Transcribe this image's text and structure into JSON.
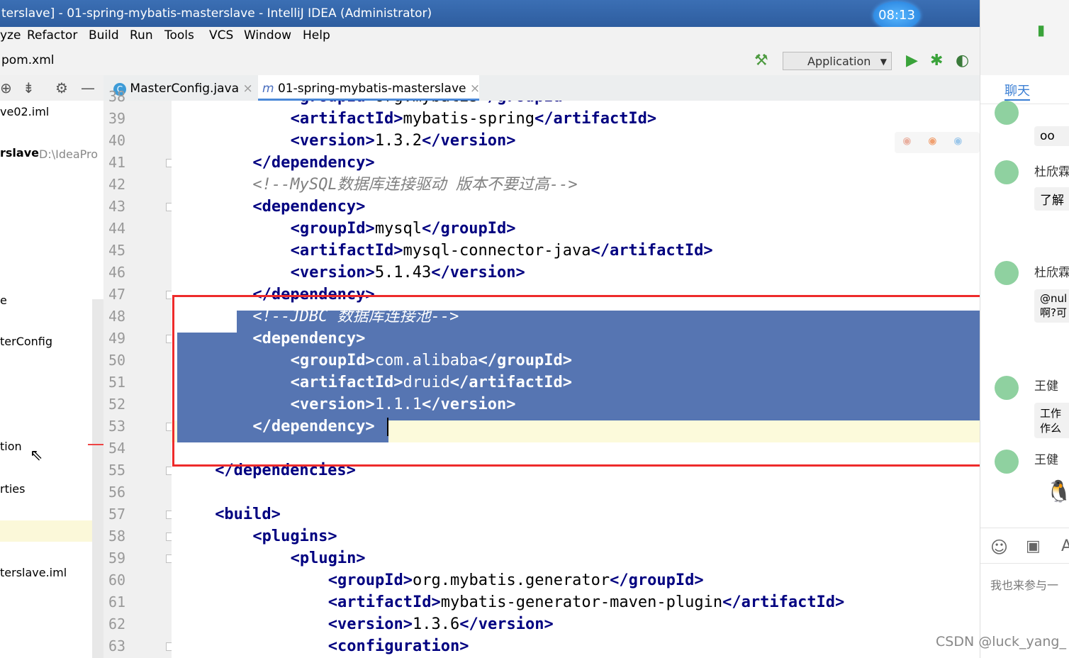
{
  "window": {
    "title": "terslave] - 01-spring-mybatis-masterslave - IntelliJ IDEA (Administrator)",
    "clock": "08:13"
  },
  "menu": [
    "yze",
    "Refactor",
    "Build",
    "Run",
    "Tools",
    "VCS",
    "Window",
    "Help"
  ],
  "navbar": {
    "crumb": "pom.xml",
    "run_config": "Application"
  },
  "tabs": [
    {
      "label": "MasterConfig.java",
      "icon": "C",
      "close": "×"
    },
    {
      "label": "01-spring-mybatis-masterslave",
      "icon": "m",
      "close": "×"
    }
  ],
  "project_items": [
    "ve02.iml",
    "rslave",
    "D:\\IdeaPro",
    "e",
    "terConfig",
    "tion",
    "rties",
    "terslave.iml"
  ],
  "gutter": {
    "lines": [
      "38",
      "39",
      "40",
      "41",
      "42",
      "43",
      "44",
      "45",
      "46",
      "47",
      "48",
      "49",
      "50",
      "51",
      "52",
      "53",
      "54",
      "55",
      "56",
      "57",
      "58",
      "59",
      "60",
      "61",
      "62",
      "63"
    ]
  },
  "code": [
    {
      "indent": "            ",
      "open": "<groupId>",
      "text": "org.mybatis",
      "close": "</groupId>"
    },
    {
      "indent": "            ",
      "open": "<artifactId>",
      "text": "mybatis-spring",
      "close": "</artifactId>"
    },
    {
      "indent": "            ",
      "open": "<version>",
      "text": "1.3.2",
      "close": "</version>"
    },
    {
      "indent": "        ",
      "open": "</dependency>",
      "text": "",
      "close": ""
    },
    {
      "indent": "        ",
      "comment": "<!--MySQL数据库连接驱动 版本不要过高-->"
    },
    {
      "indent": "        ",
      "open": "<dependency>",
      "text": "",
      "close": ""
    },
    {
      "indent": "            ",
      "open": "<groupId>",
      "text": "mysql",
      "close": "</groupId>"
    },
    {
      "indent": "            ",
      "open": "<artifactId>",
      "text": "mysql-connector-java",
      "close": "</artifactId>"
    },
    {
      "indent": "            ",
      "open": "<version>",
      "text": "5.1.43",
      "close": "</version>"
    },
    {
      "indent": "        ",
      "open": "</dependency>",
      "text": "",
      "close": ""
    },
    {
      "indent": "        ",
      "comment": "<!--JDBC 数据库连接池-->"
    },
    {
      "indent": "        ",
      "open": "<dependency>",
      "text": "",
      "close": ""
    },
    {
      "indent": "            ",
      "open": "<groupId>",
      "text": "com.alibaba",
      "close": "</groupId>"
    },
    {
      "indent": "            ",
      "open": "<artifactId>",
      "text": "druid",
      "close": "</artifactId>"
    },
    {
      "indent": "            ",
      "open": "<version>",
      "text": "1.1.1",
      "close": "</version>"
    },
    {
      "indent": "        ",
      "open": "</dependency>",
      "text": "",
      "close": ""
    },
    {
      "indent": "",
      "open": "",
      "text": "",
      "close": ""
    },
    {
      "indent": "    ",
      "open": "</dependencies>",
      "text": "",
      "close": ""
    },
    {
      "indent": "",
      "open": "",
      "text": "",
      "close": ""
    },
    {
      "indent": "    ",
      "open": "<build>",
      "text": "",
      "close": ""
    },
    {
      "indent": "        ",
      "open": "<plugins>",
      "text": "",
      "close": ""
    },
    {
      "indent": "            ",
      "open": "<plugin>",
      "text": "",
      "close": ""
    },
    {
      "indent": "                ",
      "open": "<groupId>",
      "text": "org.mybatis.generator",
      "close": "</groupId>"
    },
    {
      "indent": "                ",
      "open": "<artifactId>",
      "text": "mybatis-generator-maven-plugin",
      "close": "</artifactId>"
    },
    {
      "indent": "                ",
      "open": "<version>",
      "text": "1.3.6",
      "close": "</version>"
    },
    {
      "indent": "                ",
      "open": "<configuration>",
      "text": "",
      "close": ""
    }
  ],
  "chat": {
    "title": "聊天",
    "entries": [
      {
        "name": "杜欣霖",
        "msg": "oo"
      },
      {
        "name": "杜欣霖",
        "msg": "了解"
      },
      {
        "name": "杜欣霖",
        "msg": "@nul 啊?可"
      },
      {
        "name": "王健",
        "msg": "工作 作么"
      },
      {
        "name": "王健",
        "msg": ""
      }
    ],
    "input_placeholder": "我也来参与一"
  },
  "watermark": "CSDN @luck_yang_"
}
